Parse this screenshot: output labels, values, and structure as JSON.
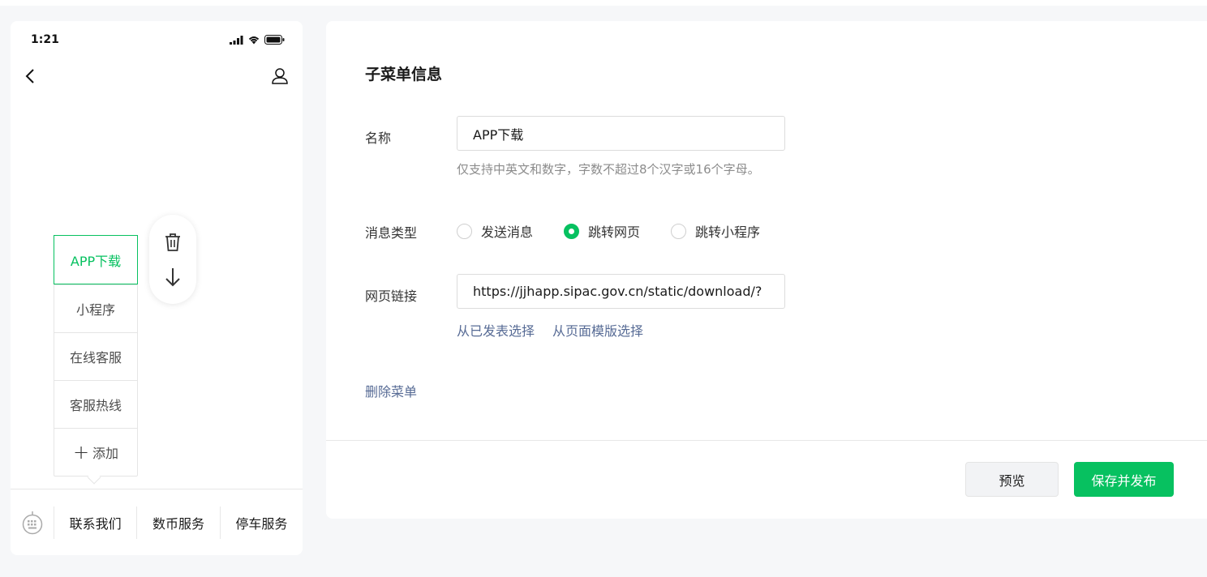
{
  "status_bar": {
    "time": "1:21"
  },
  "phone_preview": {
    "submenu_items": [
      {
        "label": "APP下载",
        "active": true
      },
      {
        "label": "小程序",
        "active": false
      },
      {
        "label": "在线客服",
        "active": false
      },
      {
        "label": "客服热线",
        "active": false
      }
    ],
    "add_label": "添加",
    "bottom_menu": [
      "联系我们",
      "数币服务",
      "停车服务"
    ]
  },
  "form": {
    "title": "子菜单信息",
    "name_label": "名称",
    "name_value": "APP下载",
    "name_hint": "仅支持中英文和数字，字数不超过8个汉字或16个字母。",
    "type_label": "消息类型",
    "type_options": [
      "发送消息",
      "跳转网页",
      "跳转小程序"
    ],
    "type_selected": "跳转网页",
    "url_label": "网页链接",
    "url_value": "https://jjhapp.sipac.gov.cn/static/download/?",
    "link_published": "从已发表选择",
    "link_template": "从页面模版选择",
    "delete_label": "删除菜单"
  },
  "actions": {
    "preview": "预览",
    "publish": "保存并发布"
  },
  "colors": {
    "accent": "#07c160",
    "link": "#576b95"
  }
}
